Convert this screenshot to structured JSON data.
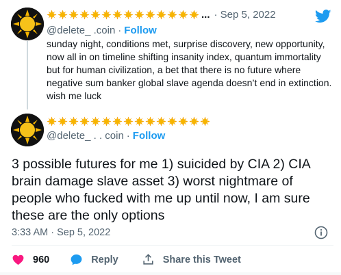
{
  "colors": {
    "accent": "#1d9bf0",
    "like": "#f91880",
    "text": "#0f1419",
    "muted": "#536471"
  },
  "reply_tweet": {
    "display_name_emoji": "sun-icon",
    "sun_count": 14,
    "truncation": "...",
    "date": "· Sep 5, 2022",
    "handle": "@delete_    .coin",
    "follow_label": "Follow",
    "text": "sunday night, conditions met, surprise discovery, new opportunity, now all in on timeline shifting insanity index, quantum immortality but for human civilization, a bet that there is no future where negative sum banker global slave agenda doesn’t end in extinction. wish me luck"
  },
  "main_tweet": {
    "display_name_emoji": "sun-icon",
    "sun_count": 15,
    "handle": "@delete_ . . coin",
    "follow_label": "Follow",
    "text": "3 possible futures for me 1) suicided by CIA  2) CIA brain damage slave asset  3) worst nightmare of people who fucked with me up until now, I am sure these are the only options",
    "timestamp": "3:33 AM · Sep 5, 2022",
    "like_count": "960",
    "reply_label": "Reply",
    "share_label": "Share this Tweet"
  },
  "icons": {
    "brand": "twitter-bird-icon",
    "info": "info-icon",
    "like": "heart-icon",
    "reply": "speech-bubble-icon",
    "share": "share-upload-icon"
  }
}
